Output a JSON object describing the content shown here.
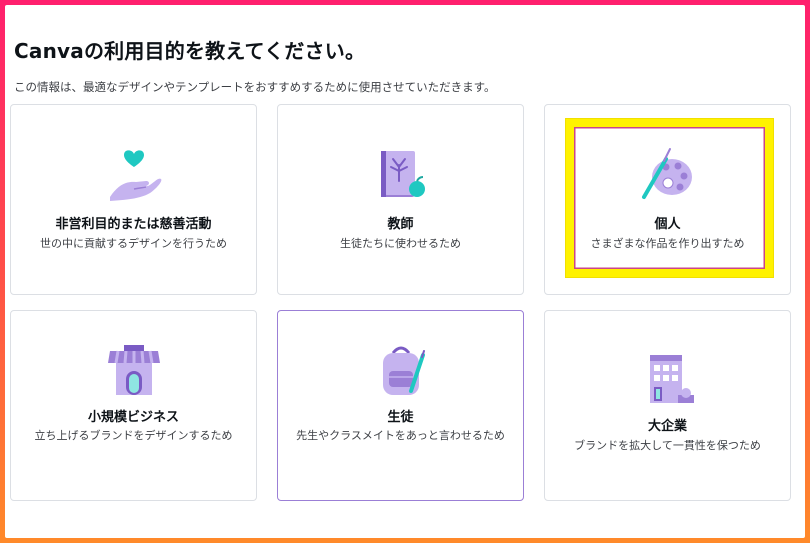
{
  "header": {
    "title": "Canvaの利用目的を教えてください。",
    "subtitle": "この情報は、最適なデザインやテンプレートをおすすめするために使用させていただきます。"
  },
  "options": [
    {
      "label": "非営利目的または慈善活動",
      "description": "世の中に貢献するデザインを行うため",
      "icon": "heart-hand-icon"
    },
    {
      "label": "教師",
      "description": "生徒たちに使わせるため",
      "icon": "book-apple-icon"
    },
    {
      "label": "個人",
      "description": "さまざまな作品を作り出すため",
      "icon": "palette-icon"
    },
    {
      "label": "小規模ビジネス",
      "description": "立ち上げるブランドをデザインするため",
      "icon": "storefront-icon"
    },
    {
      "label": "生徒",
      "description": "先生やクラスメイトをあっと言わせるため",
      "icon": "backpack-icon"
    },
    {
      "label": "大企業",
      "description": "ブランドを拡大して一貫性を保つため",
      "icon": "office-building-icon"
    }
  ],
  "colors": {
    "accent_purple": "#9b7fd6",
    "icon_teal": "#1fc8c1",
    "highlight": "#fff200",
    "frame_gradient_top": "#ff1f6e",
    "frame_gradient_bottom": "#ff8a2a"
  }
}
